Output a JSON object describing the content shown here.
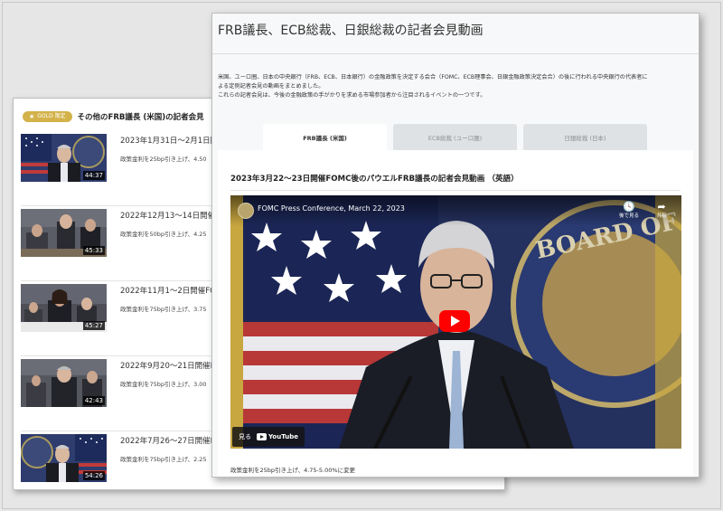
{
  "back_panel": {
    "badge": "GOLD 限定",
    "title": "その他のFRB議長 (米国)の記者会見",
    "items": [
      {
        "date": "2023年1月31日〜2月1日開",
        "desc": "政策金利を25bp引き上げ、4.50",
        "duration": "44:37"
      },
      {
        "date": "2022年12月13〜14日開催",
        "desc": "政策金利を50bp引き上げ、4.25",
        "duration": "45:33"
      },
      {
        "date": "2022年11月1〜2日開催FO",
        "desc": "政策金利を75bp引き上げ、3.75",
        "duration": "45:27"
      },
      {
        "date": "2022年9月20〜21日開催F",
        "desc": "政策金利を75bp引き上げ、3.00",
        "duration": "42:43"
      },
      {
        "date": "2022年7月26〜27日開催F",
        "desc": "政策金利を75bp引き上げ、2.25",
        "duration": "54:26"
      }
    ]
  },
  "front_panel": {
    "title": "FRB議長、ECB総裁、日銀総裁の記者会見動画",
    "intro_line1": "米国、ユーロ圏、日本の中央銀行（FRB、ECB、日本銀行）の金融政策を決定する会合（FOMC、ECB理事会、日銀金融政策決定会合）の後に行われる中央銀行の代表者に",
    "intro_line2": "よる定例記者会見の動画をまとめました。",
    "intro_line3": "これらの記者会見は、今後の金融政策の手がかりを求める市場参加者から注目されるイベントの一つです。",
    "tabs": [
      {
        "label": "FRB議長 (米国)",
        "active": true
      },
      {
        "label": "ECB総裁 (ユーロ圏)",
        "active": false
      },
      {
        "label": "日銀総裁 (日本)",
        "active": false
      }
    ],
    "video_heading": "2023年3月22〜23日開催FOMC後のパウエルFRB議長の記者会見動画 （英語）",
    "player": {
      "title": "FOMC Press Conference, March 22, 2023",
      "watch_later": "後で見る",
      "share": "共有",
      "watch_label": "見る",
      "youtube": "YouTube"
    },
    "caption": "政策金利を25bp引き上げ、4.75-5.00%に変更"
  }
}
